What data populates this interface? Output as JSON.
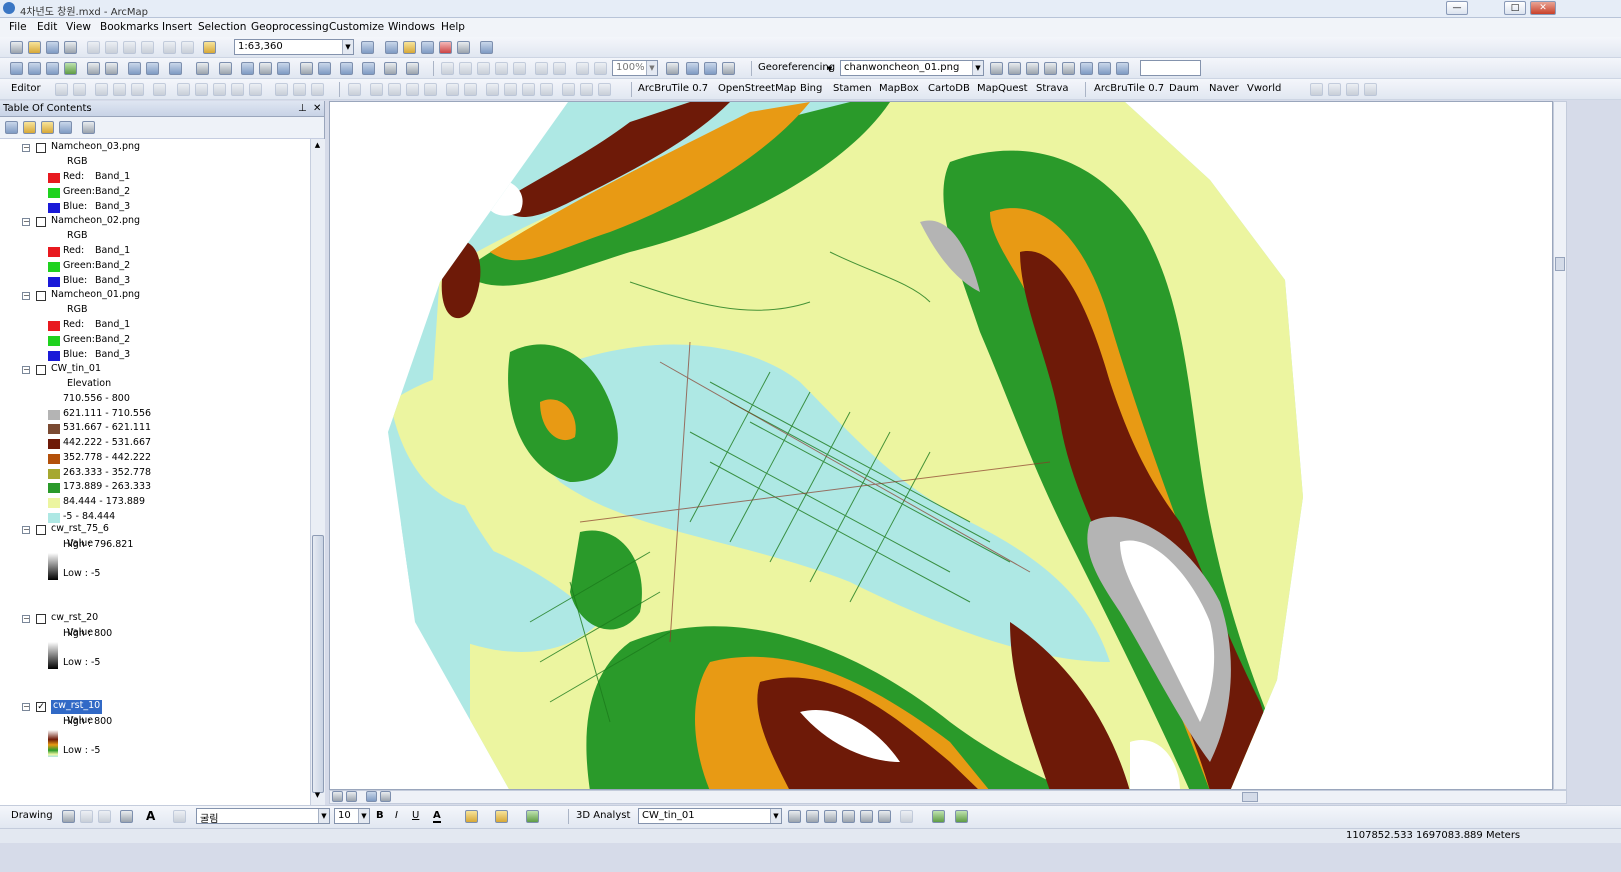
{
  "window": {
    "title": "4차년도 창원.mxd - ArcMap",
    "min": "—",
    "max": "□",
    "close": "✕"
  },
  "menu": [
    "File",
    "Edit",
    "View",
    "Bookmarks",
    "Insert",
    "Selection",
    "Geoprocessing",
    "Customize",
    "Windows",
    "Help"
  ],
  "standard_toolbar": {
    "scale": "1:63,360"
  },
  "tools_toolbar": {
    "zoom_percent": "100%",
    "georeferencing_label": "Georeferencing",
    "georef_layer": "chanwoncheon_01.png"
  },
  "editor_toolbar": {
    "editor_label": "Editor",
    "tile_menus": [
      "ArcBruTile 0.7",
      "OpenStreetMap",
      "Bing",
      "Stamen",
      "MapBox",
      "CartoDB",
      "MapQuest",
      "Strava"
    ],
    "tile_menus2": [
      "ArcBruTile 0.7",
      "Daum",
      "Naver",
      "Vworld"
    ]
  },
  "toc": {
    "title": "Table Of Contents",
    "pin": "⊥",
    "close": "✕",
    "layers": [
      {
        "name": "Namcheon_03.png",
        "checked": false,
        "sub": "RGB",
        "bands": [
          {
            "ch": "Red:",
            "band": "Band_1",
            "color": "#e8191f"
          },
          {
            "ch": "Green:",
            "band": "Band_2",
            "color": "#1fd21f"
          },
          {
            "ch": "Blue:",
            "band": "Band_3",
            "color": "#1a1ad8"
          }
        ]
      },
      {
        "name": "Namcheon_02.png",
        "checked": false,
        "sub": "RGB",
        "bands": [
          {
            "ch": "Red:",
            "band": "Band_1",
            "color": "#e8191f"
          },
          {
            "ch": "Green:",
            "band": "Band_2",
            "color": "#1fd21f"
          },
          {
            "ch": "Blue:",
            "band": "Band_3",
            "color": "#1a1ad8"
          }
        ]
      },
      {
        "name": "Namcheon_01.png",
        "checked": false,
        "sub": "RGB",
        "bands": [
          {
            "ch": "Red:",
            "band": "Band_1",
            "color": "#e8191f"
          },
          {
            "ch": "Green:",
            "band": "Band_2",
            "color": "#1fd21f"
          },
          {
            "ch": "Blue:",
            "band": "Band_3",
            "color": "#1a1ad8"
          }
        ]
      },
      {
        "name": "CW_tin_01",
        "checked": false,
        "sub": "Elevation",
        "classes": [
          {
            "label": "710.556 - 800",
            "color": "#ffffff"
          },
          {
            "label": "621.111 - 710.556",
            "color": "#b4b4b4"
          },
          {
            "label": "531.667 - 621.111",
            "color": "#7a4a32"
          },
          {
            "label": "442.222 - 531.667",
            "color": "#6e1a08"
          },
          {
            "label": "352.778 - 442.222",
            "color": "#b3500a"
          },
          {
            "label": "263.333 - 352.778",
            "color": "#a6a830"
          },
          {
            "label": "173.889 - 263.333",
            "color": "#2a9a2a"
          },
          {
            "label": "84.444 - 173.889",
            "color": "#ecf5a0"
          },
          {
            "label": "-5 - 84.444",
            "color": "#aee8e4"
          }
        ]
      },
      {
        "name": "cw_rst_75_6",
        "checked": false,
        "sub": "Value",
        "high": "High : 796.821",
        "low": "Low : -5",
        "ramp": "gray"
      },
      {
        "name": "cw_rst_20",
        "checked": false,
        "sub": "Value",
        "high": "High : 800",
        "low": "Low : -5",
        "ramp": "gray"
      },
      {
        "name": "cw_rst_10",
        "checked": true,
        "selected": true,
        "sub": "Value",
        "high": "High : 800",
        "low": "Low : -5",
        "ramp": "elev"
      }
    ]
  },
  "drawing_toolbar": {
    "drawing_label": "Drawing",
    "font": "굴림",
    "size": "10",
    "bold": "B",
    "italic": "I",
    "underline": "U",
    "font_color": "A",
    "analyst_label": "3D Analyst",
    "analyst_layer": "CW_tin_01"
  },
  "status": {
    "coords": "1107852.533  1697083.889 Meters"
  },
  "colors": {
    "water": "#aee8e4",
    "low": "#ecf5a0",
    "green": "#2a9a2a",
    "orange": "#e89a14",
    "brown": "#6e1a08",
    "white": "#ffffff"
  }
}
